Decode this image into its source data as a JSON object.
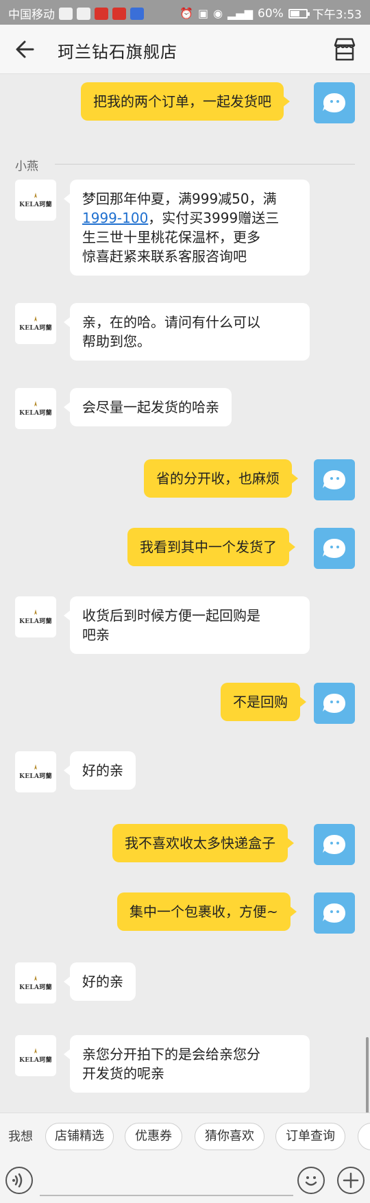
{
  "status_bar": {
    "carrier": "中国移动",
    "battery": "60%",
    "battery_level": 0.6,
    "time": "下午3:53",
    "network": "4G"
  },
  "header": {
    "title": "珂兰钻石旗舰店",
    "back_icon": "back-arrow-icon",
    "store_icon": "store-icon"
  },
  "chat": {
    "sender_label": "小燕",
    "shop_avatar_text": "KELA珂蘭",
    "messages": [
      {
        "side": "right",
        "text": "把我的两个订单，一起发货吧"
      },
      {
        "side": "left",
        "text_parts": [
          "梦回那年仲夏，满999减50，满\n",
          "1999-100",
          "，实付买3999赠送三\n生三世十里桃花保温杯，更多\n惊喜赶紧来联系客服咨询吧"
        ]
      },
      {
        "side": "left",
        "text": "亲，在的哈。请问有什么可以\n帮助到您。"
      },
      {
        "side": "left",
        "text": "会尽量一起发货的哈亲"
      },
      {
        "side": "right",
        "text": "省的分开收，也麻烦"
      },
      {
        "side": "right",
        "text": "我看到其中一个发货了"
      },
      {
        "side": "left",
        "text": "收货后到时候方便一起回购是\n吧亲"
      },
      {
        "side": "right",
        "text": "不是回购"
      },
      {
        "side": "left",
        "text": "好的亲"
      },
      {
        "side": "right",
        "text": "我不喜欢收太多快递盒子"
      },
      {
        "side": "right",
        "text": "集中一个包裹收，方便~"
      },
      {
        "side": "left",
        "text": "好的亲"
      },
      {
        "side": "left",
        "text": "亲您分开拍下的是会给亲您分\n开发货的呢亲"
      }
    ]
  },
  "quick_bar": {
    "label": "我想",
    "chips": [
      "店铺精选",
      "优惠券",
      "猜你喜欢",
      "订单查询"
    ]
  },
  "input_bar": {
    "placeholder": "",
    "voice_icon": "voice-icon",
    "emoji_icon": "emoji-icon",
    "plus_icon": "plus-icon"
  },
  "colors": {
    "user_bubble": "#ffd633",
    "shop_bubble": "#ffffff",
    "user_avatar": "#5fb6ea",
    "link": "#1e6fcf"
  }
}
